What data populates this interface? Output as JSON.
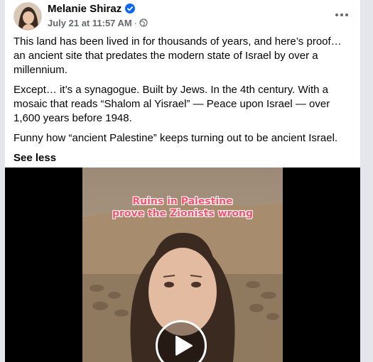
{
  "post": {
    "author": "Melanie Shiraz",
    "verified": true,
    "timestamp": "July 21 at 11:57 AM",
    "separator": "·",
    "audience_icon": "globe-icon",
    "more_icon": "more-options-icon",
    "paragraphs": [
      "This land has been lived in for thousands of years, and here’s proof… an ancient site that predates the modern state of Israel by over a millennium.",
      "Except… it’s a synagogue. Built by Jews. In the 4th century. With a mosaic that reads “Shalom al Yisrael” — Peace upon Israel — over 1,600 years before 1948.",
      "Funny how “ancient Palestine” keeps turning out to be ancient Israel."
    ],
    "see_less": "See less"
  },
  "video": {
    "overlay_line1": "Ruins in Palestine",
    "overlay_line2": "prove the Zionists wrong",
    "play_icon": "play-icon"
  },
  "colors": {
    "verified_blue": "#0866ff",
    "meta_gray": "#65676b",
    "overlay_pink": "#ff4f6a",
    "video_bg": "#000000"
  }
}
